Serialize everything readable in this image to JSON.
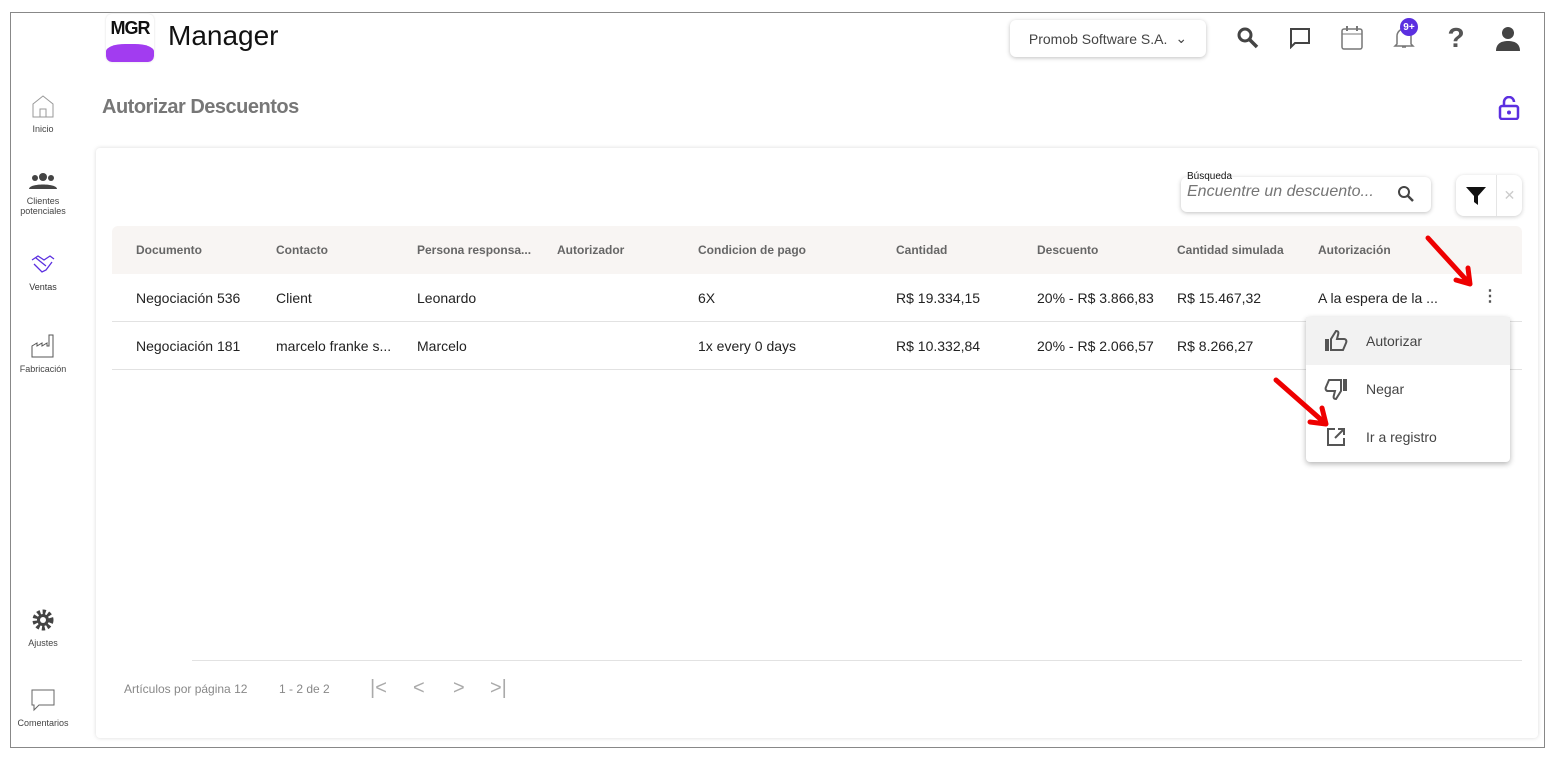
{
  "app": {
    "logo_text": "MGR",
    "name": "Manager"
  },
  "header": {
    "company": "Promob Software S.A.",
    "notifications_badge": "9+"
  },
  "sidebar": {
    "items": [
      {
        "label": "Inicio"
      },
      {
        "label": "Clientes potenciales"
      },
      {
        "label": "Ventas"
      },
      {
        "label": "Fabricación"
      },
      {
        "label": "Ajustes"
      },
      {
        "label": "Comentarios"
      }
    ]
  },
  "page": {
    "title": "Autorizar Descuentos"
  },
  "search": {
    "label": "Búsqueda",
    "placeholder": "Encuentre un descuento..."
  },
  "table": {
    "headers": [
      "Documento",
      "Contacto",
      "Persona responsa...",
      "Autorizador",
      "Condicion de pago",
      "Cantidad",
      "Descuento",
      "Cantidad simulada",
      "Autorización"
    ],
    "rows": [
      [
        "Negociación 536",
        "Client",
        "Leonardo",
        "",
        "6X",
        "R$ 19.334,15",
        "20% - R$ 3.866,83",
        "R$ 15.467,32",
        "A la espera de la ..."
      ],
      [
        "Negociación 181",
        "marcelo franke s...",
        "Marcelo",
        "",
        "1x every 0 days",
        "R$ 10.332,84",
        "20% - R$ 2.066,57",
        "R$ 8.266,27",
        ""
      ]
    ]
  },
  "menu": {
    "items": [
      {
        "label": "Autorizar"
      },
      {
        "label": "Negar"
      },
      {
        "label": "Ir a registro"
      }
    ]
  },
  "pagination": {
    "items_per_page": "Artículos por página 12",
    "range": "1 - 2 de 2"
  },
  "colors": {
    "accent": "#5b2fe0",
    "logo": "#a23cf0",
    "annotation": "#ee0000"
  }
}
